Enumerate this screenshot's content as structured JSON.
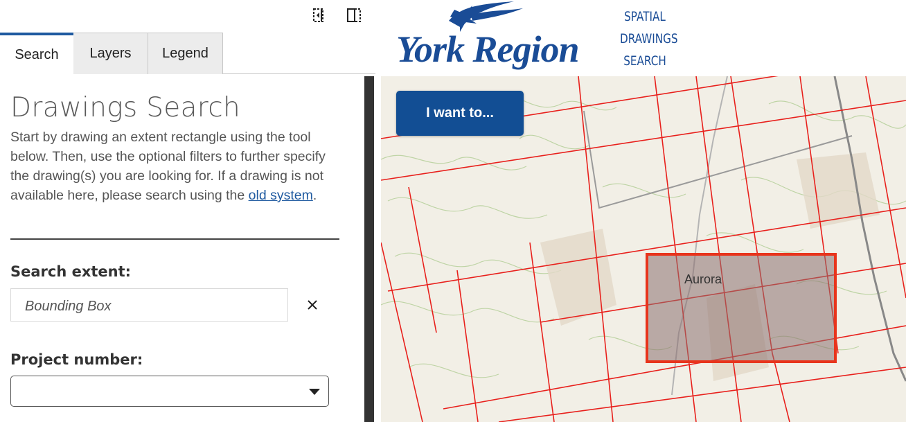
{
  "toolbar": {
    "collapse_icon": "collapse-panel-icon",
    "split_icon": "split-view-icon"
  },
  "tabs": [
    {
      "label": "Search",
      "active": true
    },
    {
      "label": "Layers",
      "active": false
    },
    {
      "label": "Legend",
      "active": false
    }
  ],
  "search": {
    "title": "Drawings Search",
    "description_before": "Start by drawing an extent rectangle using the tool below. Then, use the optional filters to further specify the drawing(s) you are looking for. If a drawing is not available here, please search using the ",
    "link_text": "old system",
    "description_after": ".",
    "extent_label": "Search extent:",
    "extent_value": "Bounding Box",
    "project_label": "Project number:",
    "project_value": ""
  },
  "header": {
    "logo_text": "York Region",
    "app_title_lines": [
      "SPATIAL",
      "DRAWINGS",
      "SEARCH"
    ]
  },
  "map": {
    "iwant_label": "I want to...",
    "place_label": "Aurora",
    "grid_color": "#e8201c",
    "selection_fill": "#8a6f6f"
  },
  "colors": {
    "accent": "#124e94",
    "brand": "#1a4c96",
    "tab_active_border": "#1f5aa0"
  }
}
